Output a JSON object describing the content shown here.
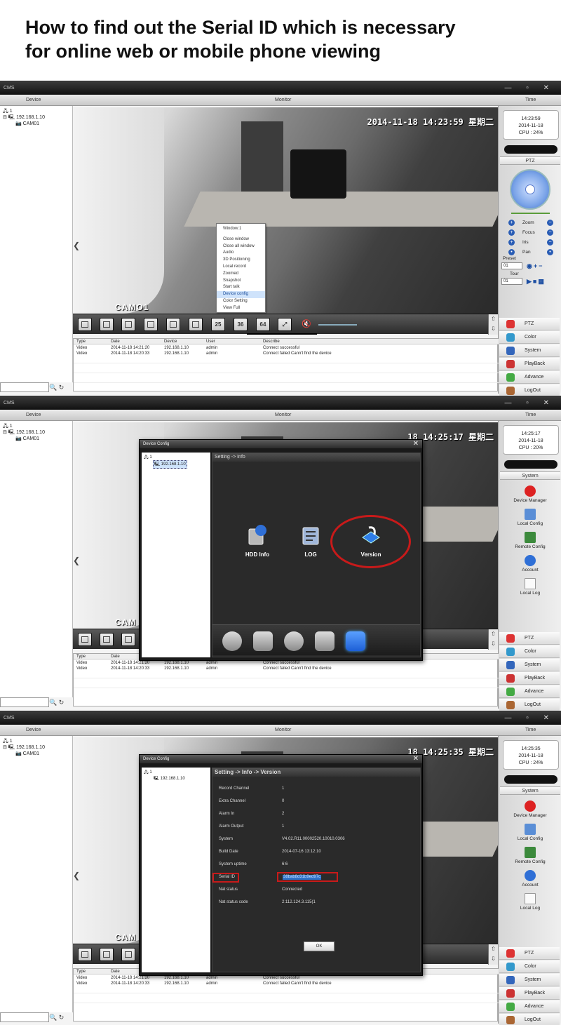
{
  "heading": {
    "line1": "How to find out the Serial ID which is necessary",
    "line2": "for online web or mobile phone viewing"
  },
  "app": {
    "title": "CMS",
    "window_controls": "— ▫ ✕",
    "columns": {
      "device": "Device",
      "monitor": "Monitor",
      "time": "Time"
    },
    "tree": {
      "root": "1",
      "device": "192.168.1.10",
      "camera": "CAM01"
    },
    "tree_tools": "🔍 ↻",
    "camera_label": "CAMO1",
    "camera_label_partial": "CAM",
    "timestamp_1": "2014-11-18 14:23:59 星期二",
    "timestamp_2": "18 14:25:17 星期二",
    "timestamp_3": "18 14:25:35 星期二",
    "clock_1": {
      "time": "14:23:59",
      "date": "2014-11-18",
      "cpu": "CPU : 24%"
    },
    "clock_2": {
      "time": "14:25:17",
      "date": "2014-11-18",
      "cpu": "CPU : 20%"
    },
    "clock_3": {
      "time": "14:25:35",
      "date": "2014-11-18",
      "cpu": "CPU : 24%"
    },
    "ptz": {
      "title": "PTZ",
      "rows": [
        "Zoom",
        "Focus",
        "Iris",
        "Pan"
      ],
      "preset_label": "Preset",
      "preset_value": "01",
      "tour_label": "Tour",
      "tour_value": "01"
    },
    "system": {
      "title": "System",
      "items": [
        "Device Manager",
        "Local Config",
        "Remote Config",
        "Account",
        "Local Log"
      ]
    },
    "nav": [
      "PTZ",
      "Color",
      "System",
      "PlayBack",
      "Advance",
      "LogOut"
    ],
    "toolbar": {
      "b25": "25",
      "b36": "36",
      "b64": "64",
      "arrows": "⇧ ⇩"
    },
    "context_menu": [
      "Window:1",
      "Close window",
      "Close all window",
      "Audio",
      "3D Positioning",
      "Local record",
      "Zoomed",
      "Snapshot",
      "Start talk",
      "Device config",
      "Color Setting",
      "View Full"
    ],
    "log": {
      "headers": [
        "Type",
        "Date",
        "Device",
        "User",
        "Describe"
      ],
      "rows": [
        [
          "Video",
          "2014-11-18 14:21:20",
          "192.168.1.10",
          "admin",
          "Connect successful"
        ],
        [
          "Video",
          "2014-11-18 14:20:33",
          "192.168.1.10",
          "admin",
          "Connect failed Cann't find the device"
        ]
      ]
    }
  },
  "dialog": {
    "title": "Device Config",
    "close": "✕",
    "breadcrumb_info": "Setting -> Info",
    "breadcrumb_version": "Setting -> Info -> Version",
    "icons": [
      "HDD Info",
      "LOG",
      "Version"
    ],
    "version_rows": [
      {
        "key": "Record Channel",
        "value": "1"
      },
      {
        "key": "Extra Channel",
        "value": "0"
      },
      {
        "key": "Alarm In",
        "value": "2"
      },
      {
        "key": "Alarm Output",
        "value": "1"
      },
      {
        "key": "System",
        "value": "V4.02.R11.00002520.10010.0306"
      },
      {
        "key": "Build Date",
        "value": "2014-07-16 13:12:10"
      },
      {
        "key": "System uptime",
        "value": "6:6"
      },
      {
        "key": "Serial ID",
        "value": "38bab8d31b9ed97c"
      },
      {
        "key": "Nat status",
        "value": "Connected"
      },
      {
        "key": "Nat status code",
        "value": "2:112.124.3.115(1"
      }
    ],
    "ok": "OK"
  },
  "colors": {
    "highlight_ring": "#c81a1a",
    "selection": "#2f72c8"
  }
}
